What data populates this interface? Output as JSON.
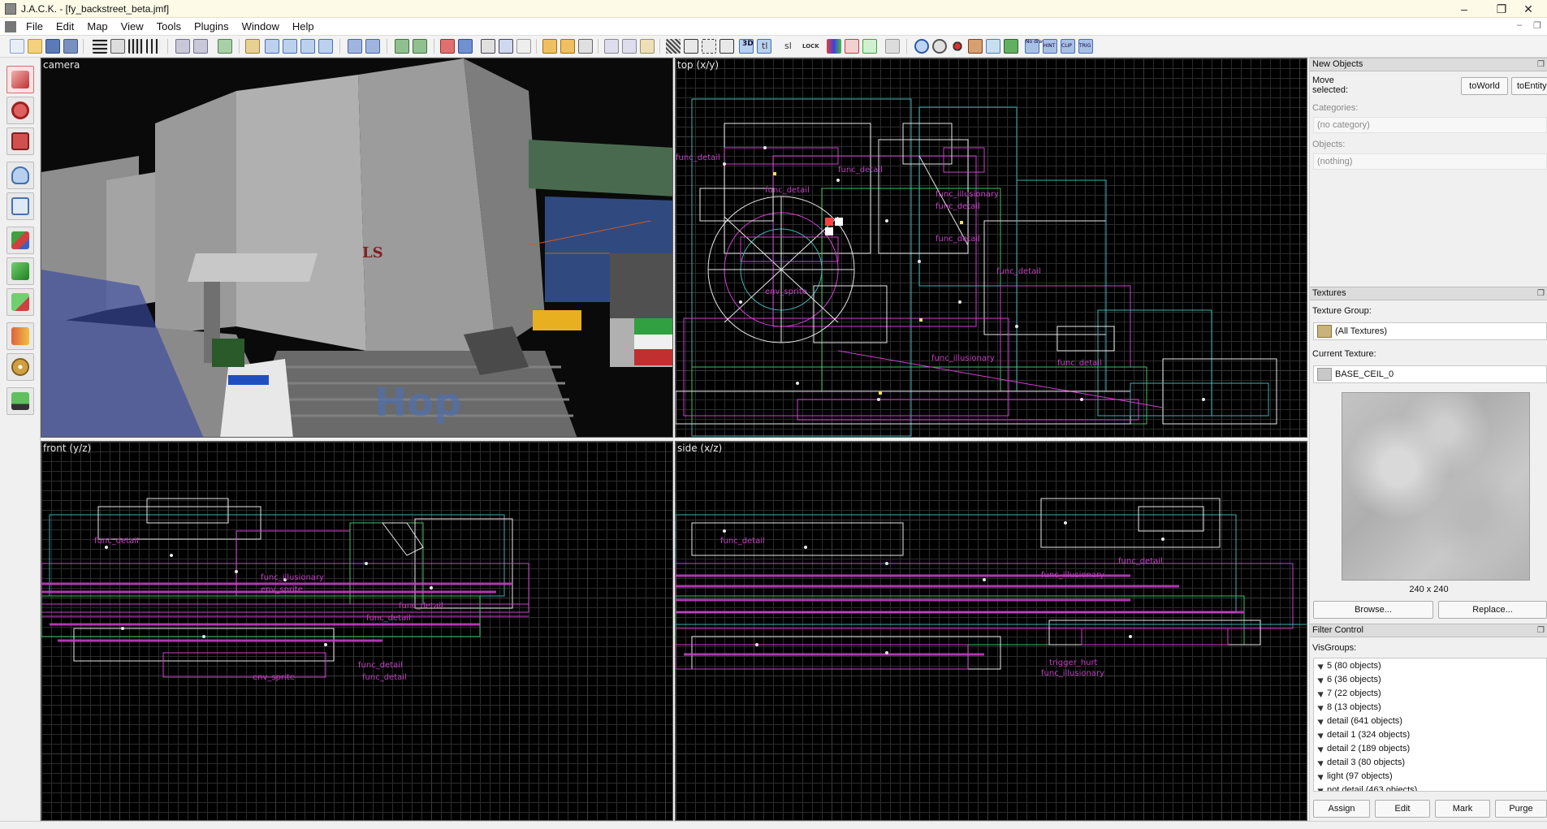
{
  "window": {
    "title": "J.A.C.K. - [fy_backstreet_beta.jmf]",
    "controls": [
      "–",
      "❐",
      "✕"
    ]
  },
  "menu": [
    "File",
    "Edit",
    "Map",
    "View",
    "Tools",
    "Plugins",
    "Window",
    "Help"
  ],
  "toolbar": {
    "text_buttons": [
      "3D",
      "tl",
      "sl",
      "LOCK",
      "No draw",
      "HINT",
      "CLIP",
      "TRIG"
    ]
  },
  "left_tools": [
    {
      "name": "selection-tool",
      "icon": "cursor-arrow-icon",
      "active": true
    },
    {
      "name": "magnify-tool",
      "icon": "magnifier-icon"
    },
    {
      "name": "camera-tool",
      "icon": "camera-icon"
    },
    {
      "name": "entity-tool",
      "icon": "lightbulb-icon"
    },
    {
      "name": "block-tool",
      "icon": "cube-outline-icon"
    },
    {
      "name": "texture-tool",
      "icon": "colored-cube-icon"
    },
    {
      "name": "apply-texture-tool",
      "icon": "green-cube-icon"
    },
    {
      "name": "decal-tool",
      "icon": "green-cube-red-icon"
    },
    {
      "name": "clip-tool",
      "icon": "book-icon"
    },
    {
      "name": "vertex-tool",
      "icon": "gears-icon"
    },
    {
      "name": "path-tool",
      "icon": "truck-icon"
    }
  ],
  "viewports": {
    "camera": "camera",
    "top": "top (x/y)",
    "front": "front (y/z)",
    "side": "side (x/z)"
  },
  "entity_labels": {
    "top": [
      "func_detail",
      "func_detail",
      "func_detail",
      "func_illusionary",
      "func_detail",
      "func_detail",
      "env_sprite",
      "func_detail",
      "func_illusionary",
      "func_detail"
    ],
    "front": [
      "func_detail",
      "func_illusionary",
      "env_sprite",
      "func_detail",
      "func_detail",
      "func_detail",
      "env_sprite",
      "func_detail"
    ],
    "side": [
      "func_detail",
      "func_illusionary",
      "trigger_hurt",
      "func_illusionary",
      "func_detail"
    ]
  },
  "new_objects": {
    "header": "New Objects",
    "move_selected": "Move selected:",
    "to_world": "toWorld",
    "to_entity": "toEntity",
    "categories_label": "Categories:",
    "categories_value": "(no category)",
    "objects_label": "Objects:",
    "objects_value": "(nothing)"
  },
  "textures": {
    "header": "Textures",
    "group_label": "Texture Group:",
    "group_value": "(All Textures)",
    "current_label": "Current Texture:",
    "current_value": "BASE_CEIL_0",
    "size": "240 x 240",
    "browse": "Browse...",
    "replace": "Replace..."
  },
  "filter": {
    "header": "Filter Control",
    "visgroups_label": "VisGroups:",
    "visgroups": [
      "5 (80 objects)",
      "6 (36 objects)",
      "7 (22 objects)",
      "8 (13 objects)",
      "detail (641 objects)",
      "detail 1 (324 objects)",
      "detail 2 (189 objects)",
      "detail 3 (80 objects)",
      "light (97 objects)",
      "not detail (463 objects)"
    ],
    "assign": "Assign",
    "edit": "Edit",
    "mark": "Mark",
    "purge": "Purge"
  },
  "colors": {
    "brush_white": "#e8e8e8",
    "entity_magenta": "#d040d0",
    "brush_teal": "#40b0b0",
    "brush_green": "#40c060",
    "selection_red": "#ff4040"
  }
}
